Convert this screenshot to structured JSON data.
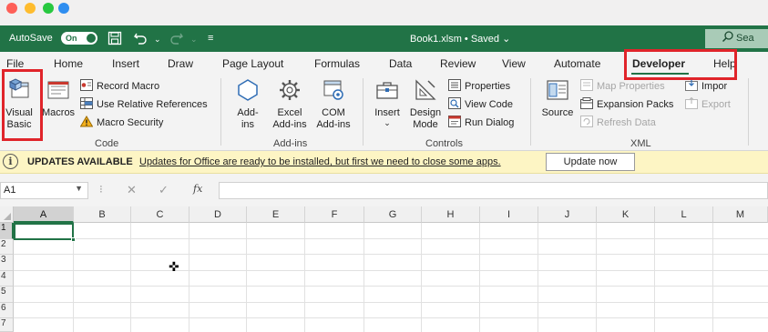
{
  "window": {
    "autosave_label": "AutoSave",
    "autosave_state": "On",
    "document_title": "Book1.xlsm • Saved",
    "search_placeholder": "Sea",
    "accent_color": "#217346"
  },
  "tabs": [
    {
      "label": "File"
    },
    {
      "label": "Home"
    },
    {
      "label": "Insert"
    },
    {
      "label": "Draw"
    },
    {
      "label": "Page Layout"
    },
    {
      "label": "Formulas"
    },
    {
      "label": "Data"
    },
    {
      "label": "Review"
    },
    {
      "label": "View"
    },
    {
      "label": "Automate"
    },
    {
      "label": "Developer",
      "active": true
    },
    {
      "label": "Help"
    }
  ],
  "ribbon": {
    "code": {
      "label": "Code",
      "visual_basic": "Visual\nBasic",
      "macros": "Macros",
      "record_macro": "Record Macro",
      "use_relative_references": "Use Relative References",
      "macro_security": "Macro Security"
    },
    "addins": {
      "label": "Add-ins",
      "addins": "Add-\nins",
      "excel_addins": "Excel\nAdd-ins",
      "com_addins": "COM\nAdd-ins"
    },
    "controls": {
      "label": "Controls",
      "insert": "Insert",
      "design_mode": "Design\nMode",
      "properties": "Properties",
      "view_code": "View Code",
      "run_dialog": "Run Dialog"
    },
    "xml": {
      "label": "XML",
      "source": "Source",
      "map_properties": "Map Properties",
      "expansion_packs": "Expansion Packs",
      "refresh_data": "Refresh Data",
      "import": "Impor",
      "export": "Export"
    }
  },
  "message_bar": {
    "title": "UPDATES AVAILABLE",
    "message": "Updates for Office are ready to be installed, but first we need to close some apps.",
    "button": "Update now"
  },
  "formula_bar": {
    "name_box": "A1",
    "fx": "fx",
    "formula": ""
  },
  "grid": {
    "columns": [
      "A",
      "B",
      "C",
      "D",
      "E",
      "F",
      "G",
      "H",
      "I",
      "J",
      "K",
      "L",
      "M"
    ],
    "rows": [
      "1",
      "2",
      "3",
      "4",
      "5",
      "6",
      "7"
    ],
    "active_cell": "A1"
  }
}
